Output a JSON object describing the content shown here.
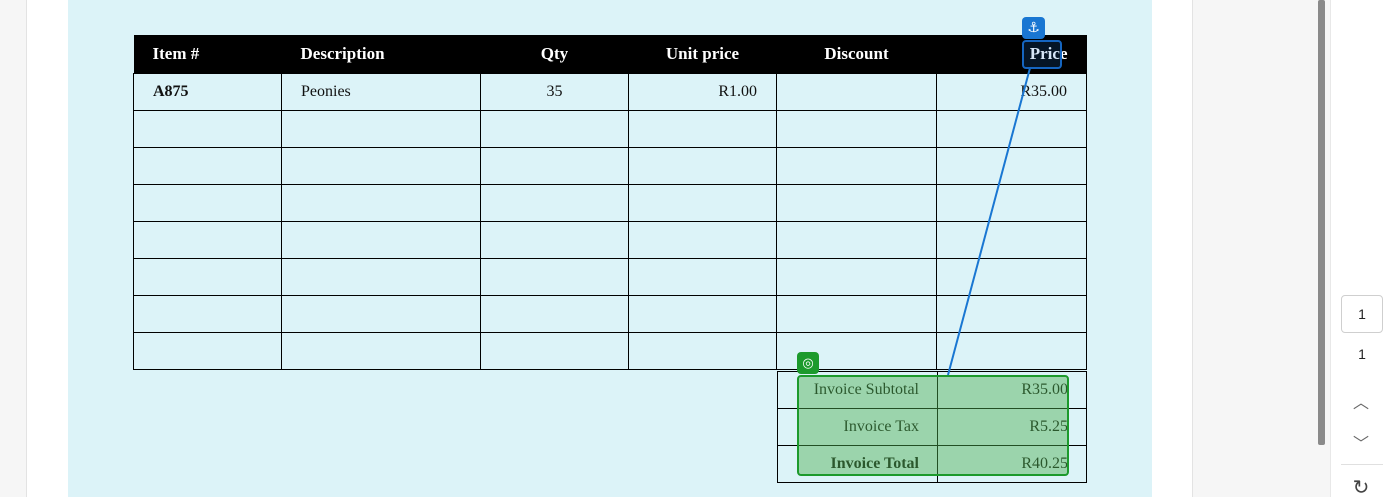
{
  "items_table": {
    "headers": [
      "Item #",
      "Description",
      "Qty",
      "Unit price",
      "Discount",
      "Price"
    ],
    "rows": [
      [
        "A875",
        "Peonies",
        "35",
        "R1.00",
        "",
        "R35.00"
      ],
      [
        "",
        "",
        "",
        "",
        "",
        ""
      ],
      [
        "",
        "",
        "",
        "",
        "",
        ""
      ],
      [
        "",
        "",
        "",
        "",
        "",
        ""
      ],
      [
        "",
        "",
        "",
        "",
        "",
        ""
      ],
      [
        "",
        "",
        "",
        "",
        "",
        ""
      ],
      [
        "",
        "",
        "",
        "",
        "",
        ""
      ],
      [
        "",
        "",
        "",
        "",
        "",
        ""
      ]
    ]
  },
  "totals": {
    "subtotal_label": "Invoice Subtotal",
    "subtotal_value": "R35.00",
    "tax_label": "Invoice Tax",
    "tax_value": "R5.25",
    "total_label": "Invoice Total",
    "total_value": "R40.25"
  },
  "annotations": {
    "anchor_icon": "anchor-icon",
    "target_icon": "target-icon",
    "anchor_color": "#1976d2",
    "target_color": "#1c9a2c"
  },
  "pager": {
    "current_page": "1",
    "total_pages": "1",
    "up_icon": "chevron-up-icon",
    "down_icon": "chevron-down-icon",
    "refresh_icon": "refresh-icon"
  },
  "colors": {
    "document_background": "#dcf3f8",
    "header_background": "#000000"
  }
}
